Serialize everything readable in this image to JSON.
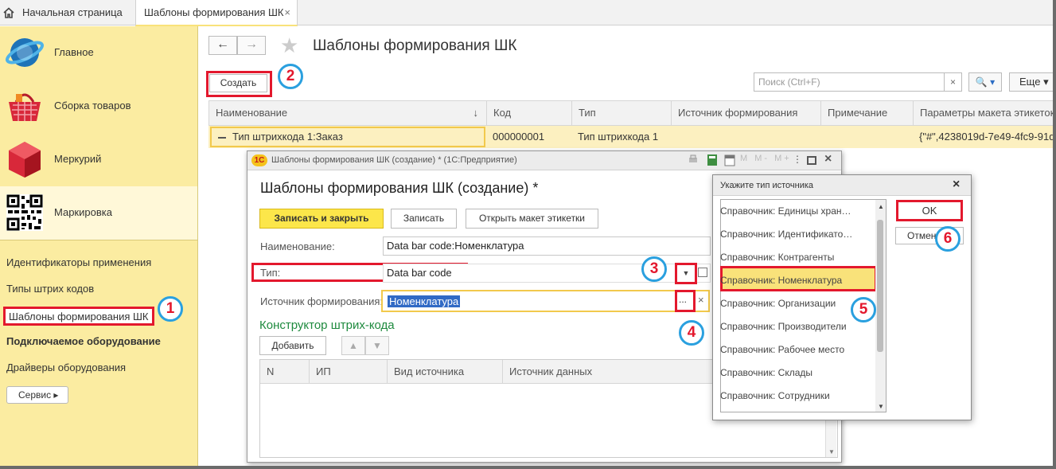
{
  "tabs": {
    "home": "Начальная страница",
    "active": "Шаблоны формирования ШК"
  },
  "sidebar": {
    "sections": [
      "Главное",
      "Сборка товаров",
      "Меркурий",
      "Маркировка"
    ],
    "links": [
      "Идентификаторы применения",
      "Типы штрих кодов",
      "Шаблоны формирования ШК",
      "Подключаемое оборудование",
      "Драйверы оборудования"
    ],
    "service": "Сервис ▸"
  },
  "main": {
    "title": "Шаблоны формирования ШК",
    "create": "Создать",
    "search_placeholder": "Поиск (Ctrl+F)",
    "search_clear": "×",
    "search_btn": "🔍 ▾",
    "more": "Еще ▾",
    "columns": [
      "Наименование",
      "Код",
      "Тип",
      "Источник формирования",
      "Примечание",
      "Параметры макета этикеток"
    ],
    "sort_icon": "↓",
    "row": [
      "Тип штрихкода 1:Заказ",
      "000000001",
      "Тип штрихкода 1",
      "",
      "",
      "{\"#\",4238019d-7e49-4fc9-91d"
    ]
  },
  "dialog1": {
    "bar_title": "Шаблоны формирования ШК (создание) *  (1С:Предприятие)",
    "logo": "1С",
    "title": "Шаблоны формирования ШК (создание) *",
    "btn_save_close": "Записать и закрыть",
    "btn_save": "Записать",
    "btn_open_layout": "Открыть макет этикетки",
    "label_name": "Наименование:",
    "value_name": "Data bar code:Номенклатура",
    "label_type": "Тип:",
    "value_type": "Data bar code",
    "label_source": "Источник формирования:",
    "value_source": "Номенклатура",
    "dots": "...",
    "clear": "×",
    "constructor_title": "Конструктор штрих-кода",
    "btn_add": "Добавить",
    "table_columns": [
      "N",
      "ИП",
      "Вид источника",
      "Источник данных"
    ]
  },
  "dialog2": {
    "title": "Укажите тип источника",
    "items": [
      "Справочник: Единицы хран…",
      "Справочник: Идентификато…",
      "Справочник: Контрагенты",
      "Справочник: Номенклатура",
      "Справочник: Организации",
      "Справочник: Производители",
      "Справочник: Рабочее место",
      "Справочник: Склады",
      "Справочник: Сотрудники"
    ],
    "ok": "OK",
    "cancel": "Отмена"
  },
  "callouts": [
    "1",
    "2",
    "3",
    "4",
    "5",
    "6"
  ]
}
